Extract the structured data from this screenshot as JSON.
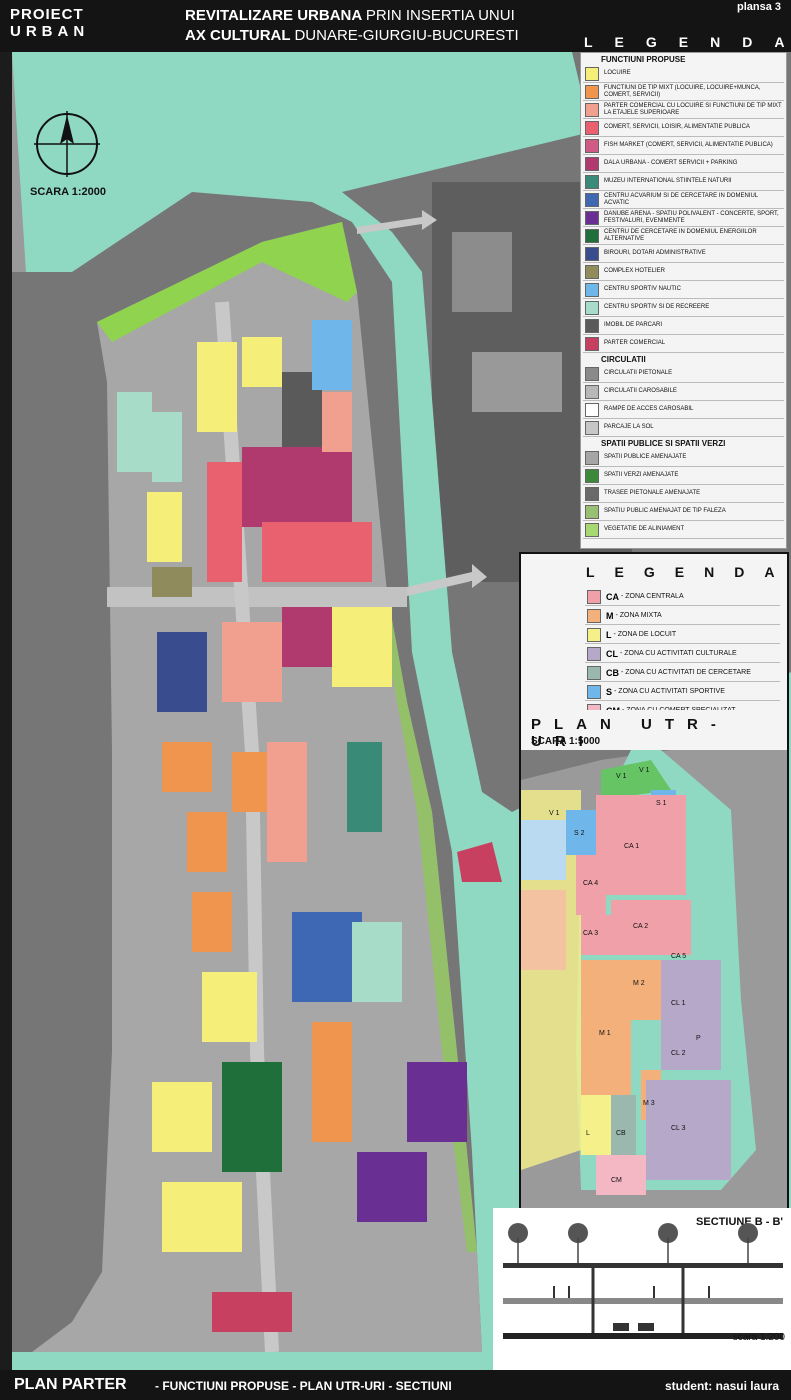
{
  "header": {
    "project_line1": "PROIECT",
    "project_line2": "URBAN",
    "title_line1_bold": "REVITALIZARE URBANA",
    "title_line1_rest": "PRIN INSERTIA UNUI",
    "title_line2_bold": "AX CULTURAL",
    "title_line2_rest": "DUNARE-GIURGIU-BUCURESTI",
    "sheet": "plansa 3",
    "legend_title": "LEGENDA"
  },
  "map": {
    "scale": "SCARA 1:2000"
  },
  "legend": {
    "sections": [
      {
        "title": "FUNCTIUNI PROPUSE",
        "items": [
          {
            "label": "LOCUIRE",
            "color": "#f5ef7a"
          },
          {
            "label": "FUNCTIUNI DE TIP MIXT (LOCUIRE, LOCUIRE+MUNCA, COMERT, SERVICII)",
            "color": "#f0954e"
          },
          {
            "label": "PARTER COMERCIAL CU LOCUIRE SI FUNCTIUNI DE TIP MIXT LA ETAJELE SUPERIOARE",
            "color": "#f1a090"
          },
          {
            "label": "COMERT, SERVICII, LOISIR, ALIMENTATIE PUBLICA",
            "color": "#e9606e"
          },
          {
            "label": "FISH MARKET (COMERT, SERVICII, ALIMENTATIE PUBLICA)",
            "color": "#cf5a86"
          },
          {
            "label": "DALA URBANA - COMERT SERVICII + PARKING",
            "color": "#b03a6d"
          },
          {
            "label": "MUZEU INTERNATIONAL STIINTELE NATURII",
            "color": "#3a8a78"
          },
          {
            "label": "CENTRU ACVARIUM SI DE CERCETARE IN DOMENIUL ACVATIC",
            "color": "#3e68b4"
          },
          {
            "label": "DANUBE ARENA - SPATIU POLIVALENT - CONCERTE, SPORT, FESTIVALURI, EVENIMENTE",
            "color": "#6a2f92"
          },
          {
            "label": "CENTRU DE CERCETARE IN DOMENIUL ENERGIILOR ALTERNATIVE",
            "color": "#1f6f3a"
          },
          {
            "label": "BIROURI, DOTARI ADMINISTRATIVE",
            "color": "#384c8e"
          },
          {
            "label": "COMPLEX HOTELIER",
            "color": "#8f8b5c"
          },
          {
            "label": "CENTRU SPORTIV NAUTIC",
            "color": "#6fb6ea"
          },
          {
            "label": "CENTRU SPORTIV SI DE RECREERE",
            "color": "#a6dcc8"
          },
          {
            "label": "IMOBIL DE PARCARI",
            "color": "#5a5a5a"
          },
          {
            "label": "PARTER COMERCIAL",
            "color": "#c84060"
          }
        ]
      },
      {
        "title": "CIRCULATII",
        "items": [
          {
            "label": "CIRCULATII PIETONALE",
            "color": "#8a8a8a"
          },
          {
            "label": "CIRCULATII CAROSABILE",
            "color": "#b8b8b8"
          },
          {
            "label": "RAMPE DE ACCES CAROSABIL",
            "color": "#ffffff"
          },
          {
            "label": "PARCAJE LA SOL",
            "color": "#c6c6c6"
          }
        ]
      },
      {
        "title": "SPATII PUBLICE SI SPATII VERZI",
        "items": [
          {
            "label": "SPATII PUBLICE AMENAJATE",
            "color": "#a6a6a6"
          },
          {
            "label": "SPATII VERZI AMENAJATE",
            "color": "#3a8a3a"
          },
          {
            "label": "TRASEE PIETONALE AMENAJATE",
            "color": "#6a6a6a"
          },
          {
            "label": "SPATIU PUBLIC AMENAJAT DE TIP FALEZA",
            "color": "#98bf73"
          },
          {
            "label": "VEGETATIE DE ALINIAMENT",
            "color": "#a8d870"
          }
        ]
      }
    ]
  },
  "legend2": {
    "title": "LEGENDA",
    "items": [
      {
        "code": "CA",
        "label": "- ZONA CENTRALA",
        "color": "#f0a0a8"
      },
      {
        "code": "M",
        "label": "- ZONA MIXTA",
        "color": "#f3b07a"
      },
      {
        "code": "L",
        "label": "- ZONA DE LOCUIT",
        "color": "#f6f08a"
      },
      {
        "code": "CL",
        "label": "- ZONA CU ACTIVITATI CULTURALE",
        "color": "#b5a8c8"
      },
      {
        "code": "CB",
        "label": "- ZONA CU ACTIVITATI DE CERCETARE",
        "color": "#9ab8ae"
      },
      {
        "code": "S",
        "label": "- ZONA CU ACTIVITATI SPORTIVE",
        "color": "#6fb6ea"
      },
      {
        "code": "CM",
        "label": "- ZONA CU COMERT SPECIALIZAT",
        "color": "#f4b8c4"
      }
    ]
  },
  "utr": {
    "title": "PLAN UTR-URI",
    "scale": "SCARA 1:5000",
    "labels": [
      "V 1",
      "V 1",
      "S 1",
      "S 2",
      "CA 1",
      "CA 4",
      "CA 3",
      "CA 2",
      "CA 5",
      "M 2",
      "CL 1",
      "M 1",
      "P",
      "CL 2",
      "M 3",
      "L",
      "CB",
      "CL 3",
      "CM",
      "V 1"
    ]
  },
  "section": {
    "title": "SECTIUNE B - B'",
    "scale": "scara 1:200"
  },
  "footer": {
    "plan": "PLAN PARTER",
    "subtitle": "- FUNCTIUNI PROPUSE - PLAN UTR-URI - SECTIUNI",
    "student": "student: nasui laura"
  }
}
